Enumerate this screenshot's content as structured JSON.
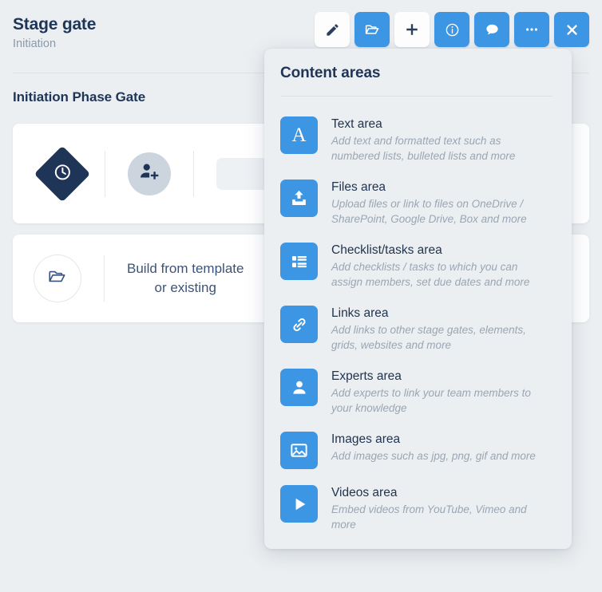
{
  "header": {
    "title": "Stage gate",
    "subtitle": "Initiation",
    "section_title": "Initiation Phase Gate"
  },
  "toolbar": {
    "buttons": [
      {
        "name": "edit-button",
        "icon": "pencil-icon",
        "style": "light"
      },
      {
        "name": "open-button",
        "icon": "folder-open-icon",
        "style": "blue"
      },
      {
        "name": "add-button",
        "icon": "plus-icon",
        "style": "light"
      },
      {
        "name": "info-button",
        "icon": "info-circle-icon",
        "style": "blue"
      },
      {
        "name": "comments-button",
        "icon": "chat-bubble-icon",
        "style": "blue"
      },
      {
        "name": "more-button",
        "icon": "ellipsis-icon",
        "style": "blue"
      },
      {
        "name": "close-button",
        "icon": "close-x-icon",
        "style": "blue"
      }
    ]
  },
  "cards": {
    "top": {
      "gate_icon": "clock-diamond-icon",
      "assign_icon": "add-person-icon",
      "placeholder_field": ""
    },
    "bottom": {
      "icon": "folder-open-outline-icon",
      "label_line1": "Build from template",
      "label_line2": "or existing"
    }
  },
  "panel": {
    "title": "Content areas",
    "items": [
      {
        "name": "Text area",
        "desc": "Add text and formatted text such as numbered lists, bulleted lists and more",
        "icon": "text-a-icon"
      },
      {
        "name": "Files area",
        "desc": "Upload files or link to files on OneDrive / SharePoint, Google Drive, Box and more",
        "icon": "upload-icon"
      },
      {
        "name": "Checklist/tasks area",
        "desc": "Add checklists / tasks to which you can assign members, set due dates and more",
        "icon": "checklist-icon"
      },
      {
        "name": "Links area",
        "desc": "Add links to other stage gates, elements, grids, websites and more",
        "icon": "link-chain-icon"
      },
      {
        "name": "Experts area",
        "desc": "Add experts to link your team members to your knowledge",
        "icon": "person-icon"
      },
      {
        "name": "Images area",
        "desc": "Add images such as jpg, png, gif and more",
        "icon": "image-icon"
      },
      {
        "name": "Videos area",
        "desc": "Embed videos from YouTube, Vimeo and more",
        "icon": "play-icon"
      }
    ]
  },
  "colors": {
    "accent_blue": "#3d96e3",
    "dark_navy": "#1f3557",
    "page_bg": "#eceff1",
    "muted_text": "#9aa6b4"
  }
}
